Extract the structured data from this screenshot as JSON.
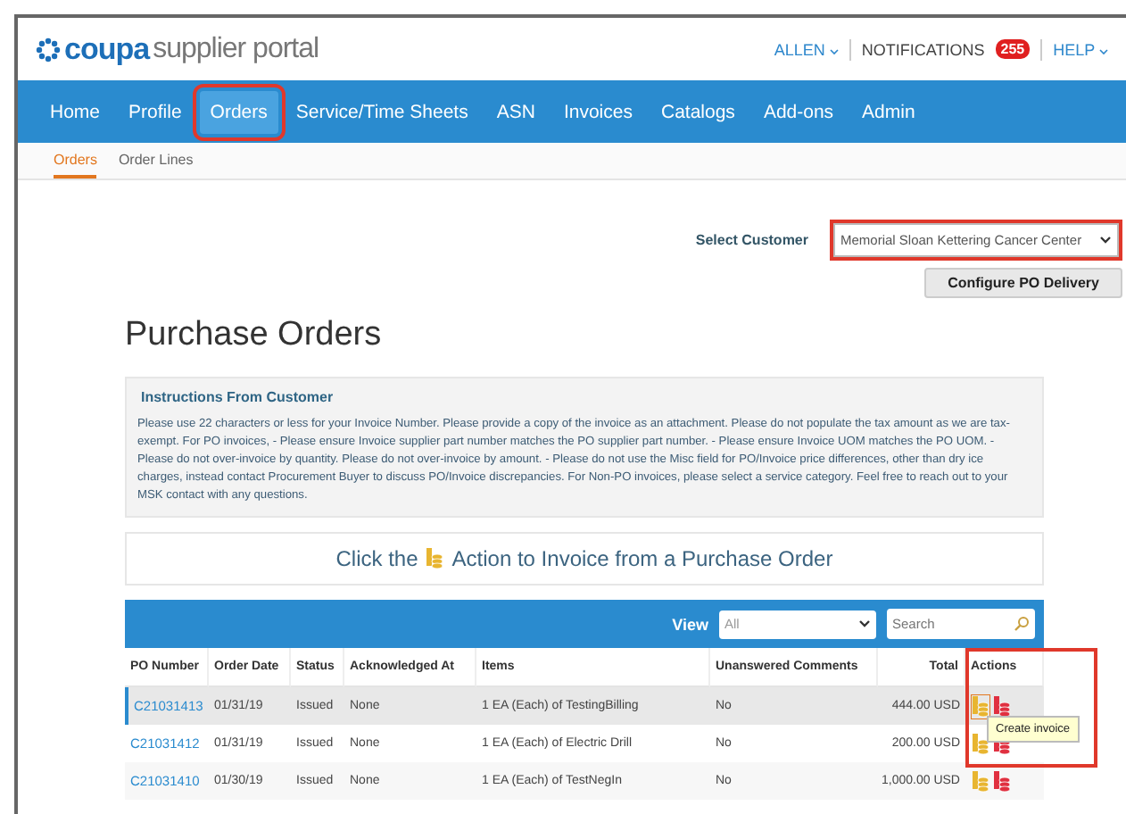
{
  "header": {
    "logo": "coupa",
    "logo_suffix": "supplier portal",
    "user": "ALLEN",
    "notifications_label": "NOTIFICATIONS",
    "notifications_count": "255",
    "help": "HELP"
  },
  "nav_tabs": [
    {
      "label": "Home",
      "selected": false,
      "highlighted": false
    },
    {
      "label": "Profile",
      "selected": false,
      "highlighted": false
    },
    {
      "label": "Orders",
      "selected": true,
      "highlighted": true
    },
    {
      "label": "Service/Time Sheets",
      "selected": false,
      "highlighted": false
    },
    {
      "label": "ASN",
      "selected": false,
      "highlighted": false
    },
    {
      "label": "Invoices",
      "selected": false,
      "highlighted": false
    },
    {
      "label": "Catalogs",
      "selected": false,
      "highlighted": false
    },
    {
      "label": "Add-ons",
      "selected": false,
      "highlighted": false
    },
    {
      "label": "Admin",
      "selected": false,
      "highlighted": false
    }
  ],
  "sub_tabs": [
    {
      "label": "Orders",
      "selected": true
    },
    {
      "label": "Order Lines",
      "selected": false
    }
  ],
  "customer": {
    "label": "Select Customer",
    "value": "Memorial Sloan Kettering Cancer Center",
    "highlighted": true
  },
  "configure_button": "Configure PO Delivery",
  "page_title": "Purchase Orders",
  "instructions": {
    "title": "Instructions From Customer",
    "text": "Please use 22 characters or less for your Invoice Number. Please provide a copy of the invoice as an attachment. Please do not populate the tax amount as we are tax-exempt. For PO invoices, - Please ensure Invoice supplier part number matches the PO supplier part number. - Please ensure Invoice UOM matches the PO UOM. - Please do not over-invoice by quantity. Please do not over-invoice by amount. - Please do not use the Misc field for PO/Invoice price differences, other than dry ice charges, instead contact Procurement Buyer to discuss PO/Invoice discrepancies. For Non-PO invoices, please select a service category. Feel free to reach out to your MSK contact with any questions."
  },
  "banner": {
    "before": "Click the",
    "after": "Action to Invoice from a Purchase Order"
  },
  "table": {
    "view_label": "View",
    "view_value": "All",
    "search_placeholder": "Search",
    "actions_highlighted": true,
    "columns": [
      "PO Number",
      "Order Date",
      "Status",
      "Acknowledged At",
      "Items",
      "Unanswered Comments",
      "Total",
      "Actions"
    ],
    "rows": [
      {
        "po": "C21031413",
        "date": "01/31/19",
        "status": "Issued",
        "ack": "None",
        "items": "1 EA (Each) of TestingBilling",
        "comments": "No",
        "total": "444.00 USD",
        "selected": true
      },
      {
        "po": "C21031412",
        "date": "01/31/19",
        "status": "Issued",
        "ack": "None",
        "items": "1 EA (Each) of Electric Drill",
        "comments": "No",
        "total": "200.00 USD",
        "selected": false
      },
      {
        "po": "C21031410",
        "date": "01/30/19",
        "status": "Issued",
        "ack": "None",
        "items": "1 EA (Each) of TestNegIn",
        "comments": "No",
        "total": "1,000.00 USD",
        "selected": false
      }
    ]
  },
  "tooltip": "Create invoice"
}
